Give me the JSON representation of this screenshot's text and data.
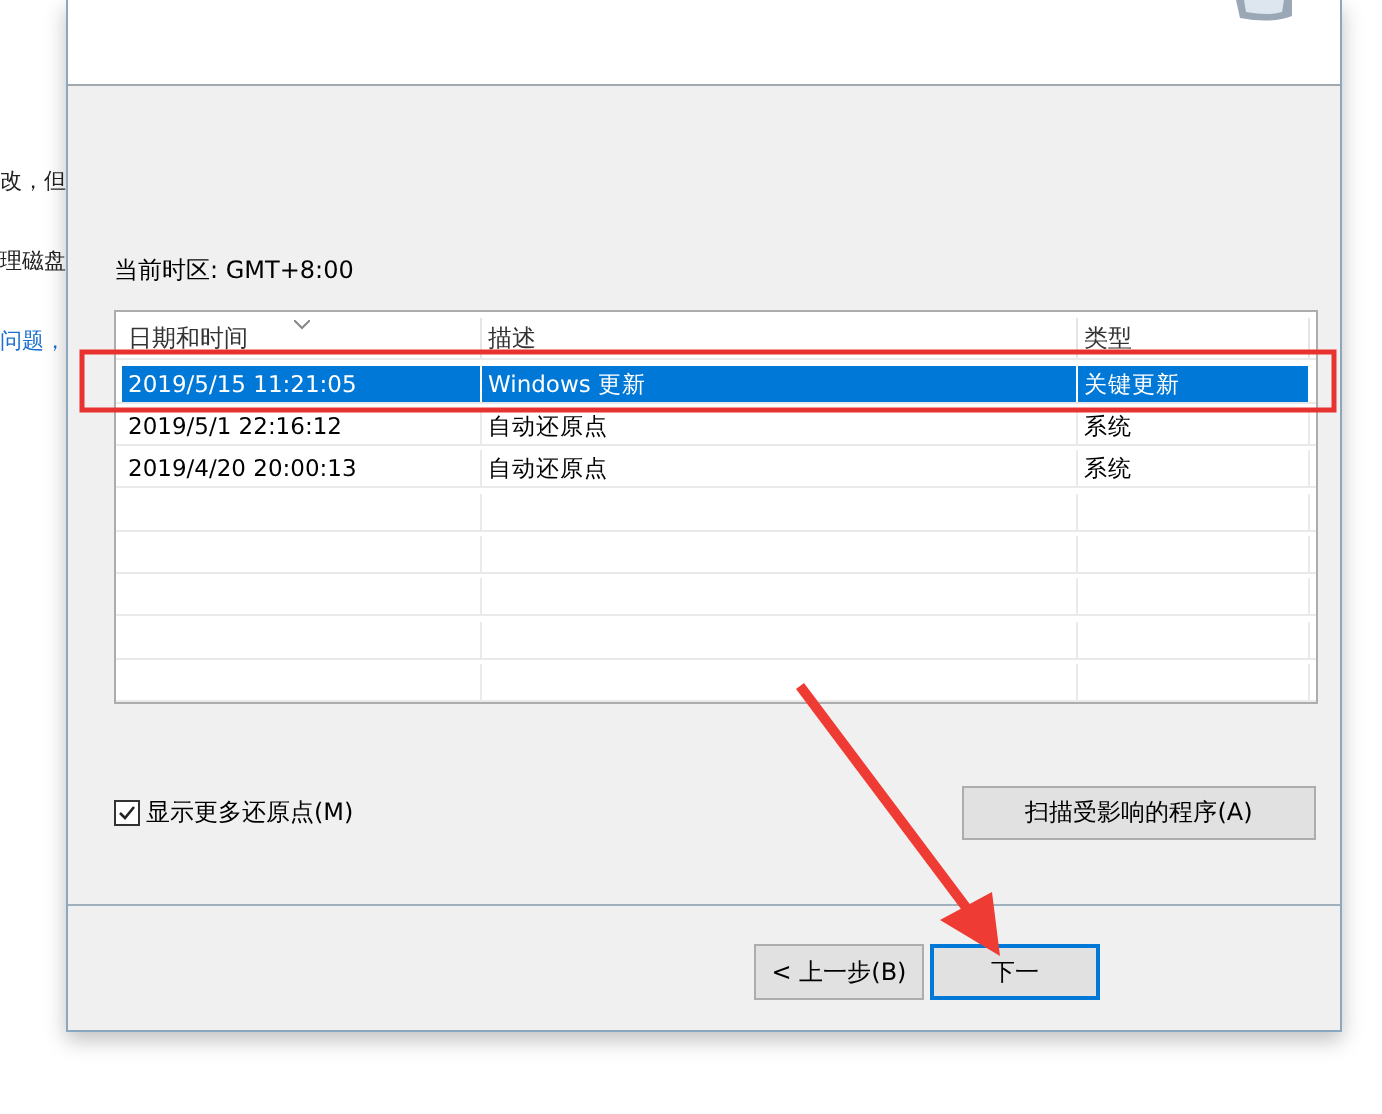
{
  "background_page": {
    "lines": [
      {
        "text": "改，但",
        "kind": "plain"
      },
      {
        "text": "理磁盘",
        "kind": "plain"
      },
      {
        "text": "问题，",
        "kind": "link"
      }
    ]
  },
  "dialog": {
    "timezone": "当前时区: GMT+8:00",
    "table": {
      "columns": [
        "日期和时间",
        "描述",
        "类型"
      ],
      "rows": [
        {
          "cells": [
            "2019/5/15 11:21:05",
            "Windows 更新",
            "关键更新"
          ],
          "selected": true
        },
        {
          "cells": [
            "2019/5/1 22:16:12",
            "自动还原点",
            "系统"
          ],
          "selected": false
        },
        {
          "cells": [
            "2019/4/20 20:00:13",
            "自动还原点",
            "系统"
          ],
          "selected": false
        }
      ]
    },
    "show_more": {
      "label": "显示更多还原点(M)",
      "checked": true
    },
    "scan_button": "扫描受影响的程序(A)",
    "buttons": [
      {
        "label": "< 上一步(B)",
        "focused": false
      },
      {
        "label": "下一",
        "focused": true
      }
    ]
  }
}
